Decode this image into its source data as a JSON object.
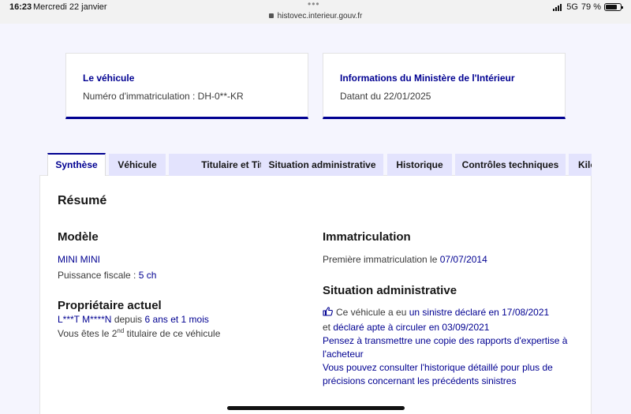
{
  "status_bar": {
    "time": "16:23",
    "date": "Mercredi 22 janvier",
    "dots": "•••",
    "url": "histovec.interieur.gouv.fr",
    "network": "5G",
    "battery": "79 %",
    "battery_level": 0.79
  },
  "cards": {
    "vehicle": {
      "title": "Le véhicule",
      "value": "Numéro d'immatriculation : DH-0**-KR"
    },
    "ministry": {
      "title": "Informations du Ministère de l'Intérieur",
      "value": "Datant du 22/01/2025"
    }
  },
  "tabs": [
    {
      "label": "Synthèse",
      "active": true
    },
    {
      "label": "Véhicule",
      "active": false
    },
    {
      "label": "Titulaire et Titre",
      "active": false
    },
    {
      "label": "Situation administrative",
      "active": false
    },
    {
      "label": "Historique",
      "active": false
    },
    {
      "label": "Contrôles techniques",
      "active": false
    },
    {
      "label": "Kilo",
      "active": false
    }
  ],
  "summary": {
    "heading": "Résumé",
    "model": {
      "heading": "Modèle",
      "name": "MINI MINI",
      "power_label": "Puissance fiscale : ",
      "power_value": "5 ch"
    },
    "owner": {
      "heading": "Propriétaire actuel",
      "name": "L***T M****N",
      "since_label": " depuis ",
      "since_value": "6 ans et 1 mois",
      "rank_prefix": "Vous êtes le 2",
      "rank_sup": "nd",
      "rank_suffix": " titulaire de ce véhicule"
    },
    "registration": {
      "heading": "Immatriculation",
      "first_label": "Première immatriculation le ",
      "first_date": "07/07/2014"
    },
    "admin": {
      "heading": "Situation administrative",
      "line1_text": "Ce véhicule a eu ",
      "line1_link": "un sinistre déclaré en 17/08/2021",
      "line2_text": "et ",
      "line2_link": "déclaré apte à circuler en 03/09/2021",
      "advice1": "Pensez à transmettre une copie des rapports d'expertise à l'acheteur",
      "advice2": "Vous pouvez consulter l'historique détaillé pour plus de précisions concernant les précédents sinistres"
    }
  }
}
